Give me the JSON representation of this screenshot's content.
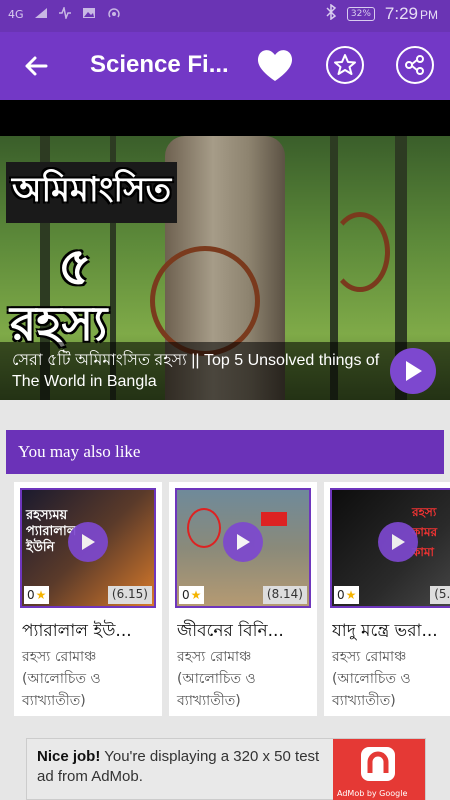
{
  "status_bar": {
    "network": "4G",
    "battery": "32%",
    "time": "7:29",
    "ampm": "PM"
  },
  "app_bar": {
    "title": "Science Fi...",
    "back_icon": "arrow-left-icon",
    "favorite_icon": "heart-icon",
    "rate_icon": "star-icon",
    "share_icon": "share-icon"
  },
  "hero": {
    "thumbnail_text": [
      "অমিমাংসিত",
      "৫",
      "রহস্য"
    ],
    "caption": "সেরা ৫টি অমিমাংসিত রহস্য || Top 5 Unsolved things of The World in Bangla",
    "play_icon": "play-icon"
  },
  "section": {
    "title": "You may also like"
  },
  "cards": [
    {
      "thumb_text": "রহস্যময় প্যারালাল ইউনি",
      "stars": "0",
      "duration": "(6.15)",
      "title": "প্যারালাল ইউ...",
      "subtitle": "রহস্য রোমাঞ্চ (আলোচিত ও ব্যাখ্যাতীত)"
    },
    {
      "thumb_text": "",
      "stars": "0",
      "duration": "(8.14)",
      "title": "জীবনের বিনি...",
      "subtitle": "রহস্য রোমাঞ্চ (আলোচিত ও ব্যাখ্যাতীত)"
    },
    {
      "thumb_text": "রহস্য কামর কামা",
      "stars": "0",
      "duration": "(5.7",
      "title": "যাদু মন্ত্রে ভরা...",
      "subtitle": "রহস্য রোমাঞ্চ (আলোচিত ও ব্যাখ্যাতীত)"
    }
  ],
  "ad": {
    "headline": "Nice job!",
    "body": " You're displaying a 320 x 50 test ad from AdMob.",
    "brand": "AdMob by Google"
  },
  "colors": {
    "primary": "#7338c6",
    "status_bar": "#6a34b4",
    "section_header": "#6b32b8",
    "play_button": "#7d48cf"
  }
}
